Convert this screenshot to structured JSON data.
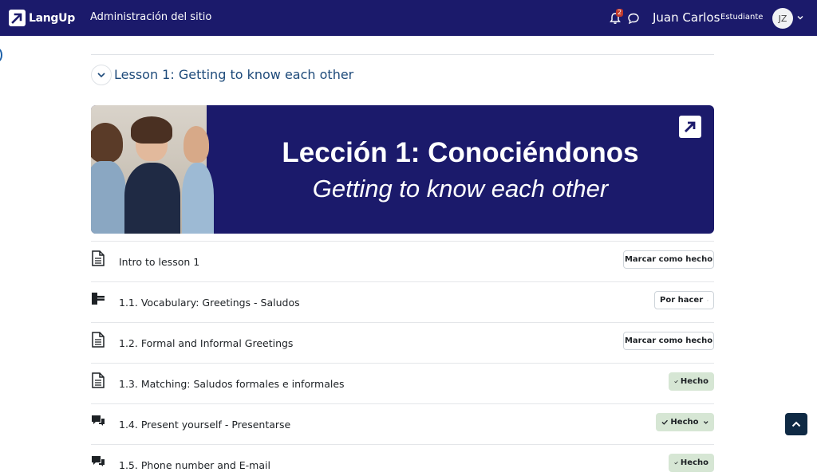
{
  "navbar": {
    "brand": "LangUp",
    "site_admin": "Administración del sitio",
    "notification_count": "2",
    "user_name": "Juan Carlos",
    "user_role": "Estudiante",
    "avatar_initials": "JZ",
    "colors": {
      "background": "#1b1a6b",
      "badge": "#c0392b"
    },
    "icons": [
      "bell-icon",
      "chat-icon",
      "chevron-down-icon"
    ]
  },
  "section": {
    "title": "Lesson 1: Getting to know each other"
  },
  "banner": {
    "title": "Lección 1: Conociéndonos",
    "subtitle": "Getting to know each other",
    "background": "#1b1a6b"
  },
  "activities": [
    {
      "icon": "page-icon",
      "name": "Intro to lesson 1",
      "status": "Marcar como hecho",
      "status_type": "toggle"
    },
    {
      "icon": "puzzle-icon",
      "name": "1.1. Vocabulary: Greetings - Saludos",
      "status": "Por hacer",
      "status_type": "dropdown"
    },
    {
      "icon": "page-icon",
      "name": "1.2. Formal and Informal Greetings",
      "status": "Marcar como hecho",
      "status_type": "toggle"
    },
    {
      "icon": "page-icon",
      "name": "1.3. Matching: Saludos formales e informales",
      "status": "Hecho",
      "status_type": "done"
    },
    {
      "icon": "forum-icon",
      "name": "1.4. Present yourself - Presentarse",
      "status": "Hecho",
      "status_type": "done-dropdown"
    },
    {
      "icon": "forum-icon",
      "name": "1.5. Phone number and E-mail",
      "status": "Hecho",
      "status_type": "done"
    }
  ],
  "colors": {
    "done_bg": "#d6e6d4",
    "title_blue": "#1d4a7a",
    "back_to_top": "#0f2a44"
  }
}
